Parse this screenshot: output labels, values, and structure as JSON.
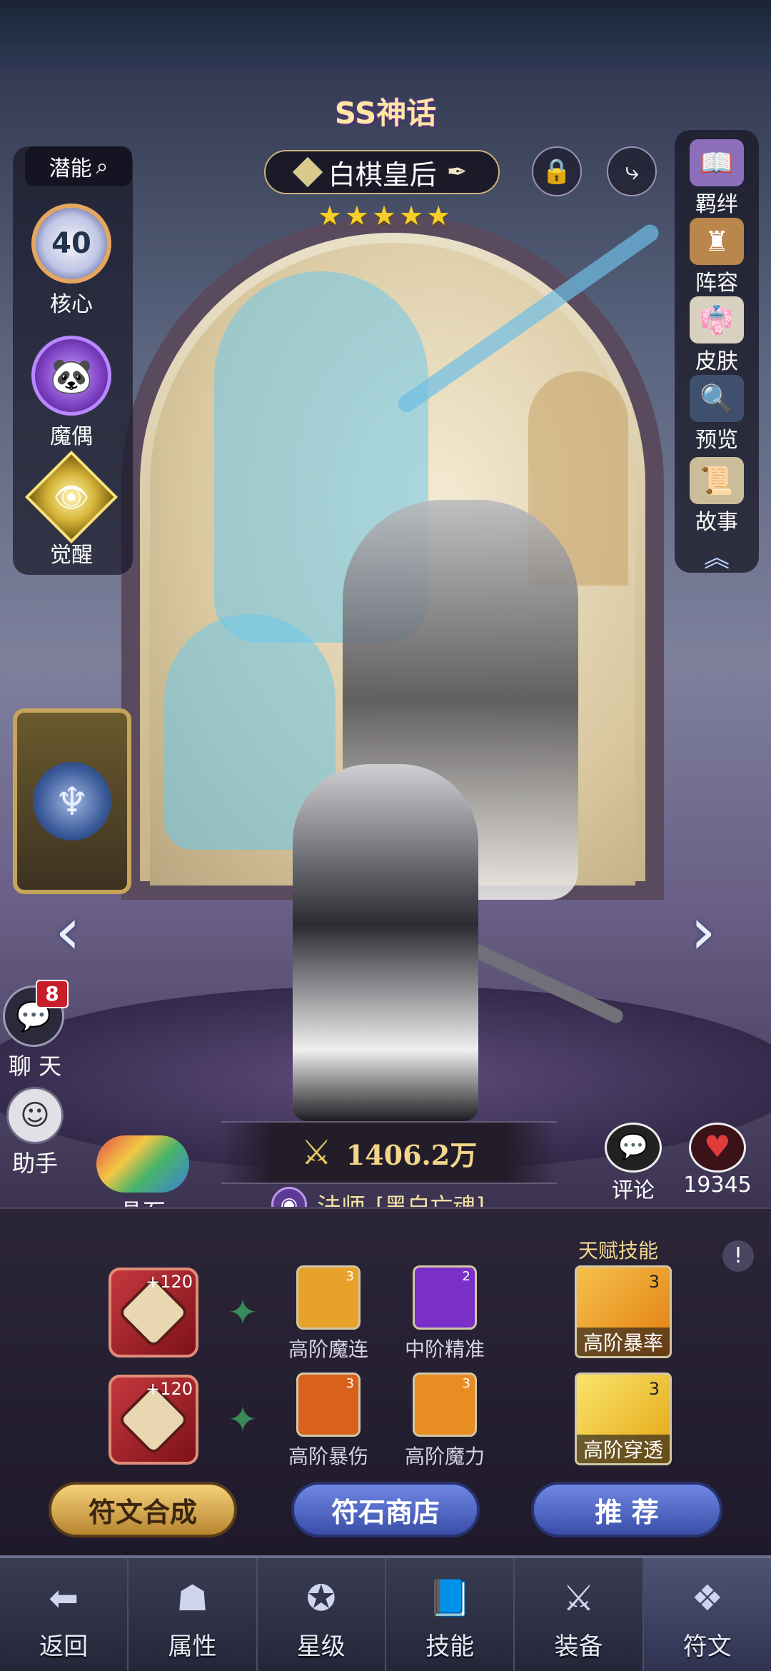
{
  "hero": {
    "rarity": "SS神话",
    "name": "白棋皇后",
    "stars": "★★★★★",
    "star_count": 5,
    "power": "1406.2万",
    "class_name": "法师",
    "faction": "[黑白亡魂]"
  },
  "left_menu": {
    "potential_label": "潜能",
    "core_level": "40",
    "core_label": "核心",
    "puppet_label": "魔偶",
    "awaken_label": "觉醒"
  },
  "right_menu": {
    "bond_label": "羁绊",
    "lineup_label": "阵容",
    "skin_label": "皮肤",
    "preview_label": "预览",
    "story_label": "故事"
  },
  "social": {
    "chat_label": "聊 天",
    "chat_badge": "8",
    "helper_label": "助手",
    "crystal_label": "晶石",
    "comment_label": "评论",
    "likes_count": "19345"
  },
  "runes": {
    "talent_title": "天赋技能",
    "slots": [
      {
        "bonus": "+120"
      },
      {
        "bonus": "+120"
      }
    ],
    "skills_row1": [
      {
        "name": "高阶魔连",
        "level": "3",
        "color": "#e8a22c"
      },
      {
        "name": "中阶精准",
        "level": "2",
        "color": "#7b2fc9"
      }
    ],
    "skills_row2": [
      {
        "name": "高阶暴伤",
        "level": "3",
        "color": "#d8611c"
      },
      {
        "name": "高阶魔力",
        "level": "3",
        "color": "#e88d22"
      }
    ],
    "talents": [
      {
        "name": "高阶暴率",
        "level": "3",
        "color": "#f2a317"
      },
      {
        "name": "高阶穿透",
        "level": "3",
        "color": "#f5c21d"
      }
    ]
  },
  "actions": {
    "synth": "符文合成",
    "shop": "符石商店",
    "recommend": "推 荐"
  },
  "bottom_nav": [
    {
      "label": "返回",
      "icon": "back-door-icon"
    },
    {
      "label": "属性",
      "icon": "hooded-figure-icon"
    },
    {
      "label": "星级",
      "icon": "star-emblem-icon"
    },
    {
      "label": "技能",
      "icon": "spellbook-icon"
    },
    {
      "label": "装备",
      "icon": "crossed-swords-icon"
    },
    {
      "label": "符文",
      "icon": "rune-crest-icon"
    }
  ]
}
